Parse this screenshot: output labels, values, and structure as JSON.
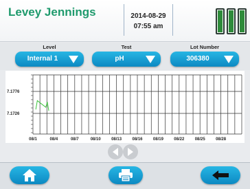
{
  "header": {
    "title": "Levey Jennings",
    "date": "2014-08-29",
    "time": "07:55 am"
  },
  "selectors": {
    "level": {
      "label": "Level",
      "value": "Internal 1"
    },
    "test": {
      "label": "Test",
      "value": "pH"
    },
    "lot": {
      "label": "Lot Number",
      "value": "306380"
    }
  },
  "footer": {
    "home_icon": "home-icon",
    "print_icon": "printer-icon",
    "back_icon": "back-arrow-icon"
  },
  "colors": {
    "accent": "#1aa3d9",
    "title": "#1f9a6d",
    "series": "#3cc43c"
  },
  "chart_data": {
    "type": "line",
    "y_ticks": [
      "7.1776",
      "7.1726"
    ],
    "x_ticks": [
      "08/1",
      "08/4",
      "08/7",
      "08/10",
      "08/13",
      "08/16",
      "08/19",
      "08/22",
      "08/25",
      "08/28"
    ],
    "series": [
      {
        "x": [
          "08/2",
          "08/2",
          "08/3",
          "08/3",
          "08/3"
        ],
        "y": [
          7.1735,
          7.1755,
          7.174,
          7.1752,
          7.1732
        ]
      }
    ]
  }
}
